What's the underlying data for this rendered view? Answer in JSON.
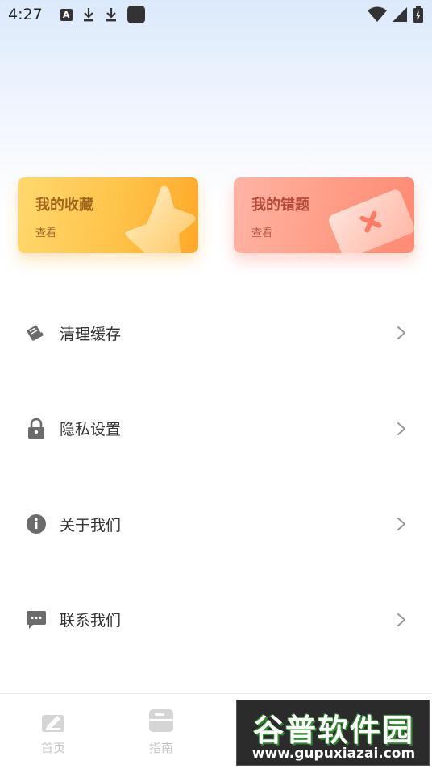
{
  "status_bar": {
    "time": "4:27",
    "notification_letter": "A"
  },
  "cards": {
    "favorites": {
      "title": "我的收藏",
      "subtitle": "查看"
    },
    "wrong_questions": {
      "title": "我的错题",
      "subtitle": "查看"
    }
  },
  "menu": {
    "items": [
      {
        "label": "清理缓存",
        "icon": "broom-icon"
      },
      {
        "label": "隐私设置",
        "icon": "lock-icon"
      },
      {
        "label": "关于我们",
        "icon": "info-icon"
      },
      {
        "label": "联系我们",
        "icon": "message-icon"
      }
    ]
  },
  "tabbar": {
    "items": [
      {
        "label": "首页",
        "icon": "home-icon"
      },
      {
        "label": "指南",
        "icon": "guide-icon"
      }
    ]
  },
  "watermark": {
    "title": "谷普软件园",
    "url": "www.gupuxiazai.com"
  },
  "colors": {
    "favorites_card": "#ffc34a",
    "wrong_card": "#ff9c86",
    "icon_gray": "#6b6b6b",
    "tab_inactive": "#c6c6c6"
  }
}
